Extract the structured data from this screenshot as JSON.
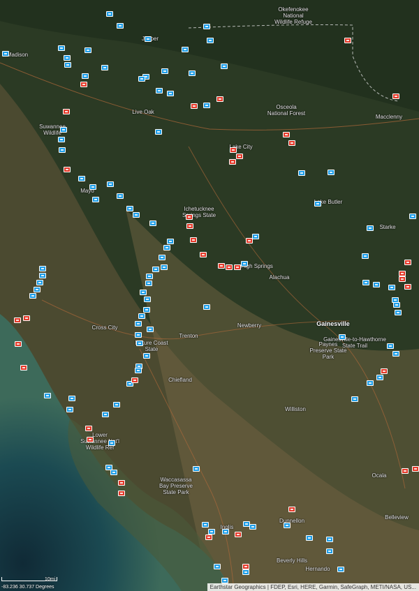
{
  "map": {
    "places": [
      {
        "name": "Okefenokee\nNational\nWildlife Refuge"
      },
      {
        "name": "Madison"
      },
      {
        "name": "Jasper"
      },
      {
        "name": "Osceola\nNational Forest"
      },
      {
        "name": "Macclenny"
      },
      {
        "name": "Live Oak"
      },
      {
        "name": "Suwannee\nWildlife"
      },
      {
        "name": "Lake City"
      },
      {
        "name": "Mayo"
      },
      {
        "name": "Lake Butler"
      },
      {
        "name": "Ichetucknee\nSprings State"
      },
      {
        "name": "Starke"
      },
      {
        "name": "High Springs"
      },
      {
        "name": "Alachua"
      },
      {
        "name": "Gainesville",
        "major": true
      },
      {
        "name": "Paynes\nPreserve State\nPark"
      },
      {
        "name": "Gainesville-to-Hawthorne\nState Trail"
      },
      {
        "name": "Cross City"
      },
      {
        "name": "Newberry"
      },
      {
        "name": "Trenton"
      },
      {
        "name": "Nature Coast\nState"
      },
      {
        "name": "Chiefland"
      },
      {
        "name": "Williston"
      },
      {
        "name": "Lower\nSuwannee Nat'l\nWildlife Ref"
      },
      {
        "name": "Waccasassa\nBay Preserve\nState Park"
      },
      {
        "name": "Ocala"
      },
      {
        "name": "Belleview"
      },
      {
        "name": "Inglis"
      },
      {
        "name": "Dunnellon"
      },
      {
        "name": "Beverly Hills"
      },
      {
        "name": "Hernando"
      }
    ],
    "marker_colors": {
      "blue": "#1e9ee8",
      "red": "#e53a2a"
    },
    "attribution": "Earthstar Geographics | FDEP, Esri, HERE, Garmin, SafeGraph, METI/NASA, US...",
    "coordinates": "-83.236 30.737 Degrees",
    "scale_label": "10mi"
  }
}
